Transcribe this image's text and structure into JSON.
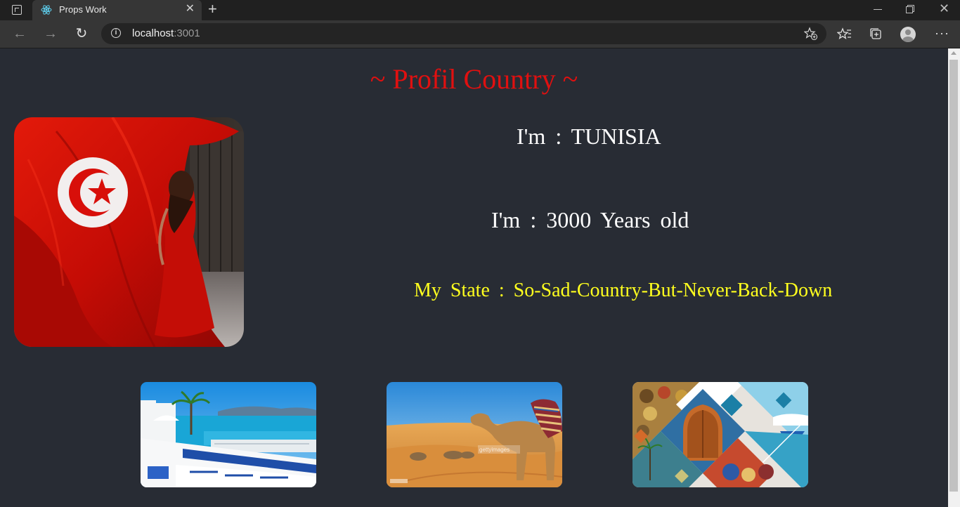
{
  "browser": {
    "tab_title": "Props Work",
    "url_host": "localhost",
    "url_port": ":3001"
  },
  "page": {
    "title": "~ Profil Country ~",
    "name_label": "I'm  :  TUNISIA",
    "age_label": "I'm  :  3000  Years  old",
    "state_label": "My  State  :  So-Sad-Country-But-Never-Back-Down"
  },
  "gallery": {
    "watermark": "gettyimages"
  },
  "colors": {
    "title": "#e01010",
    "state": "#ffff1e",
    "background": "#282c34"
  }
}
